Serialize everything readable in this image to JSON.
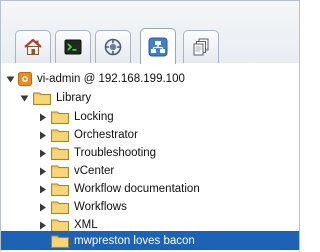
{
  "tabs": [
    {
      "name": "home-tab",
      "icon": "home-icon"
    },
    {
      "name": "console-tab",
      "icon": "console-icon"
    },
    {
      "name": "globe-tab",
      "icon": "globe-icon"
    },
    {
      "name": "workflows-tab",
      "icon": "workflow-tree-icon",
      "active": true
    },
    {
      "name": "inventory-tab",
      "icon": "stacked-documents-icon"
    }
  ],
  "tree": {
    "root": {
      "label": "vi-admin @ 192.168.199.100",
      "icon": "server-icon"
    },
    "library": {
      "label": "Library"
    },
    "children": [
      {
        "label": "Locking"
      },
      {
        "label": "Orchestrator"
      },
      {
        "label": "Troubleshooting"
      },
      {
        "label": "vCenter"
      },
      {
        "label": "Workflow documentation"
      },
      {
        "label": "Workflows"
      },
      {
        "label": "XML"
      }
    ],
    "selected": {
      "label": "mwpreston loves bacon"
    }
  },
  "colors": {
    "selection": "#1e62b5",
    "folder": "#f2c85b",
    "server_icon": "#f08a1c"
  }
}
